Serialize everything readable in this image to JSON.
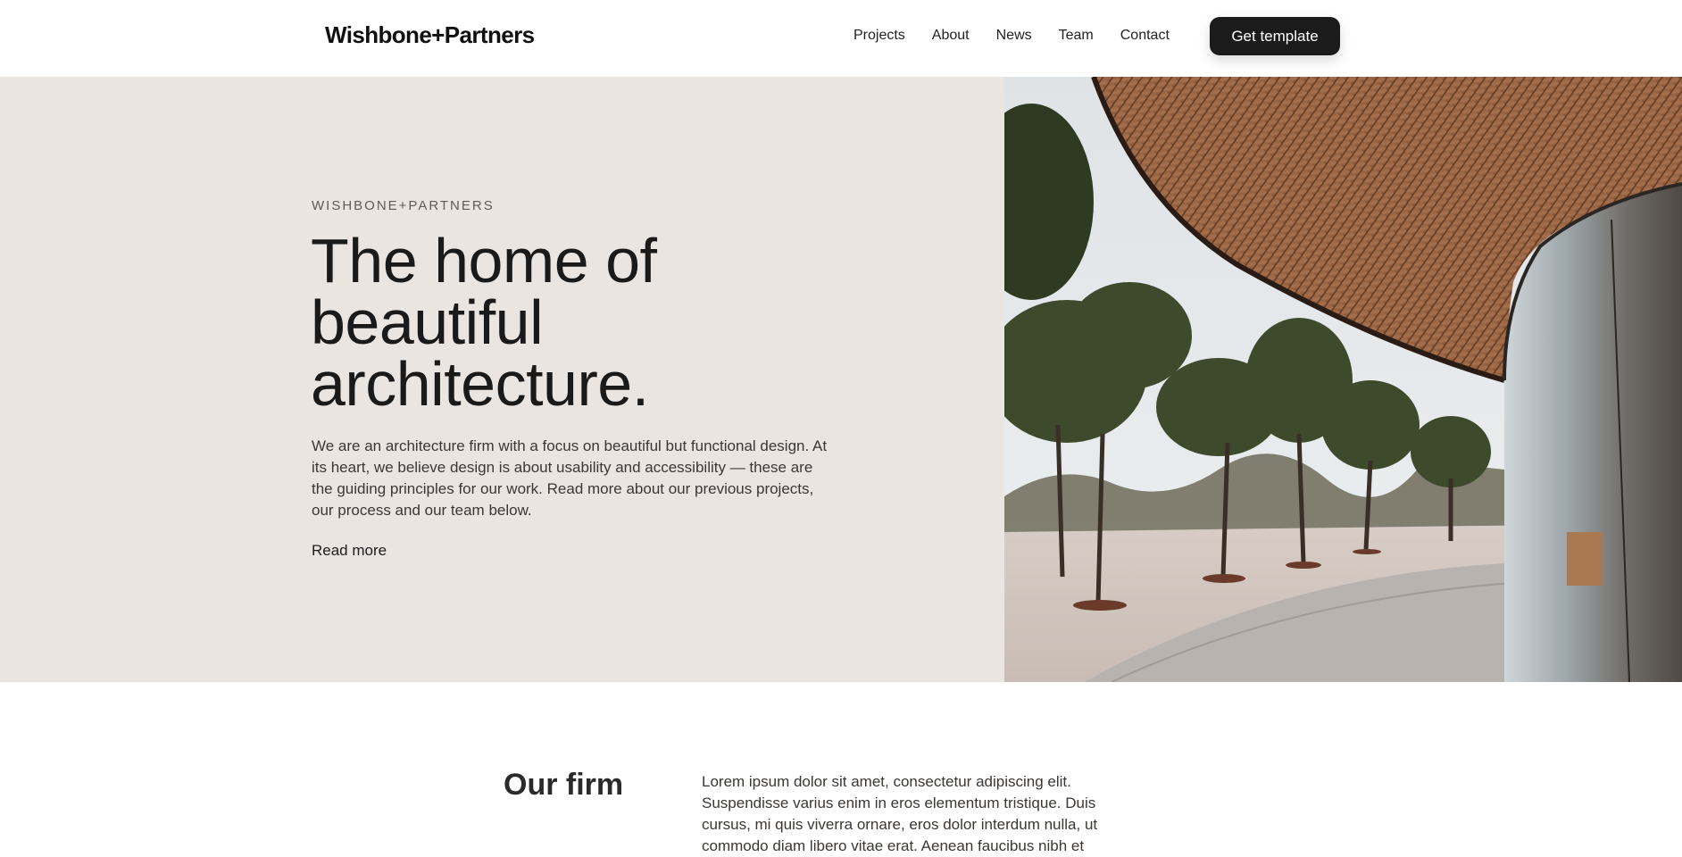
{
  "nav": {
    "logo": "Wishbone+Partners",
    "items": [
      {
        "label": "Projects"
      },
      {
        "label": "About"
      },
      {
        "label": "News"
      },
      {
        "label": "Team"
      },
      {
        "label": "Contact"
      }
    ],
    "cta_label": "Get template"
  },
  "hero": {
    "eyebrow": "WISHBONE+PARTNERS",
    "headline": "The home of beautiful architecture.",
    "body": "We are an architecture firm with a focus on beautiful but functional design. At its heart, we believe design is about usability and accessibility — these are the guiding principles for our work. Read more about our previous projects, our process and our team below.",
    "read_more": "Read more"
  },
  "firm": {
    "title": "Our firm",
    "body": "Lorem ipsum dolor sit amet, consectetur adipiscing elit. Suspendisse varius enim in eros elementum tristique. Duis cursus, mi quis viverra ornare, eros dolor interdum nulla, ut commodo diam libero vitae erat. Aenean faucibus nibh et"
  },
  "colors": {
    "hero_bg": "#ebe5e2",
    "cta_bg": "#1b1b1b",
    "text_dark": "#1a1a1a"
  }
}
